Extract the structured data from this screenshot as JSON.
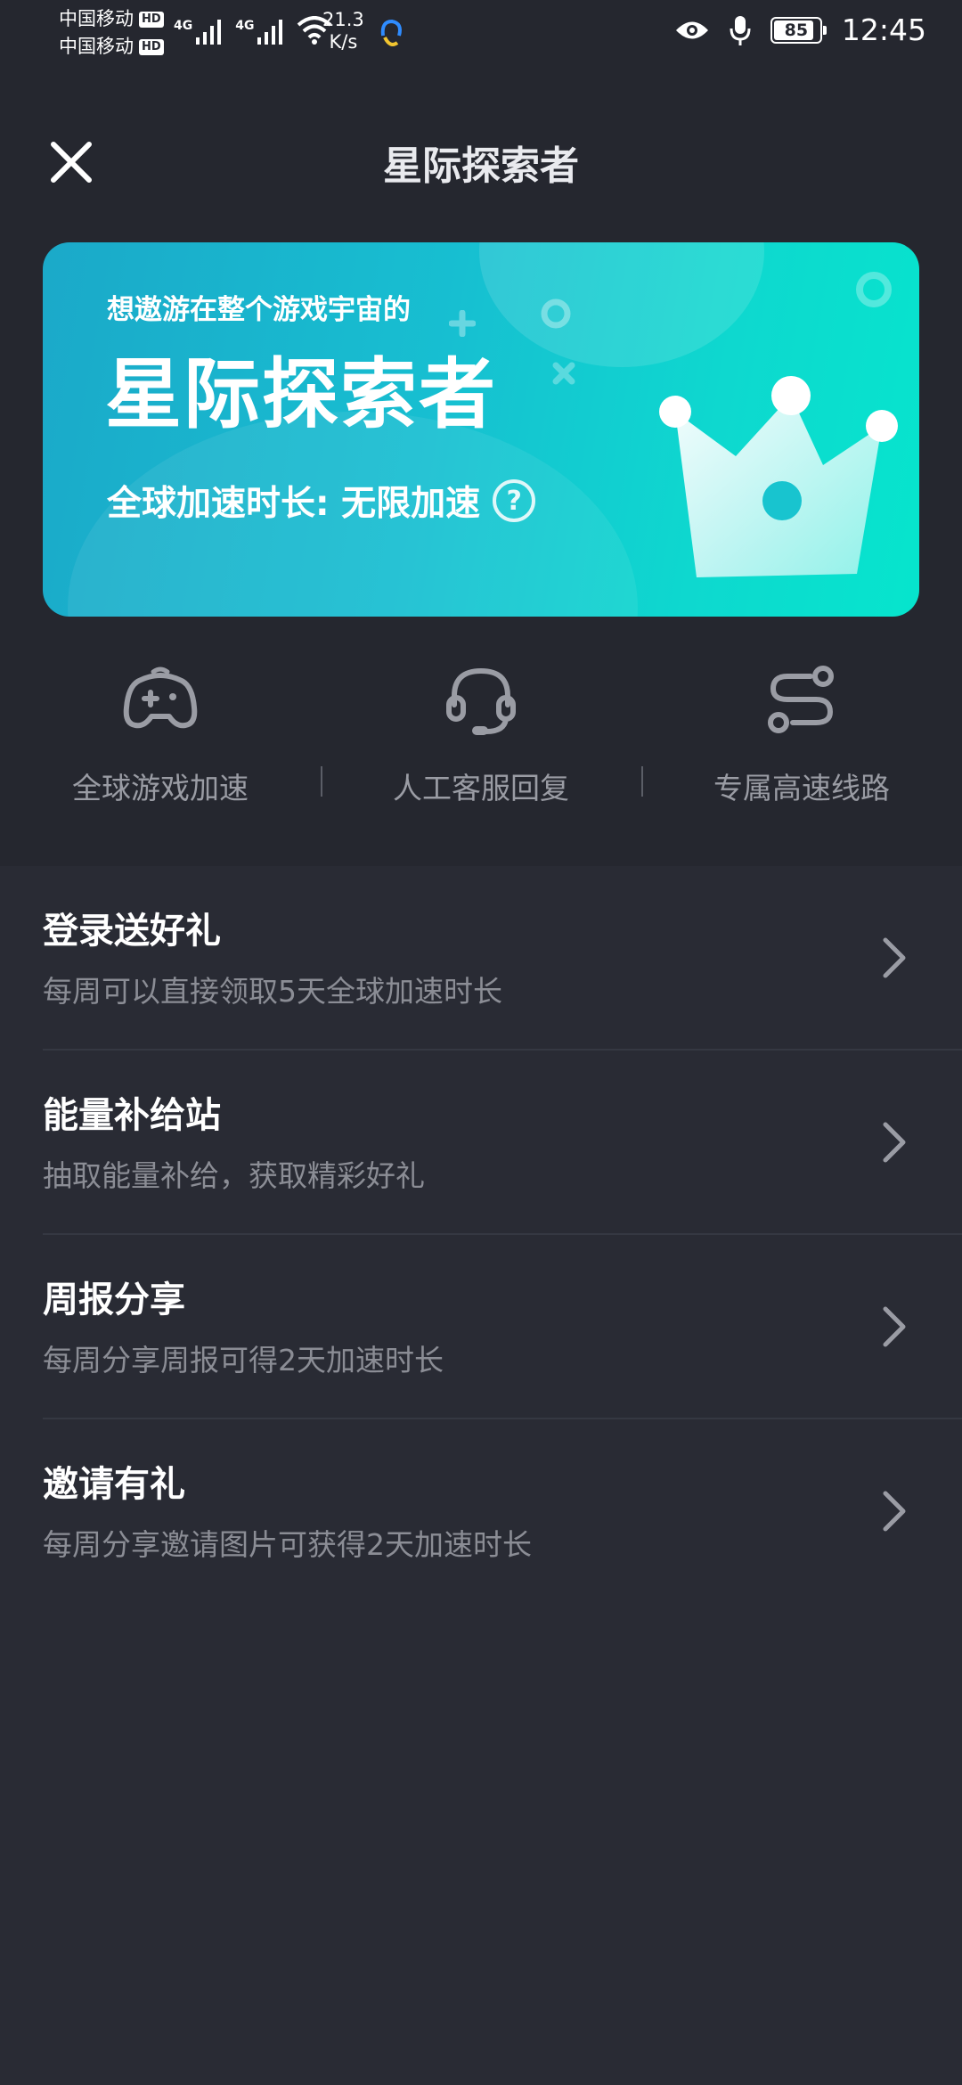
{
  "status": {
    "carrier1": "中国移动",
    "carrier2": "中国移动",
    "hd": "HD",
    "net1": "4G",
    "net2": "4G",
    "speed_value": "21.3",
    "speed_unit": "K/s",
    "battery": "85",
    "time": "12:45"
  },
  "header": {
    "title": "星际探索者"
  },
  "banner": {
    "subtitle": "想遨游在整个游戏宇宙的",
    "title": "星际探索者",
    "duration_label": "全球加速时长: 无限加速",
    "help_symbol": "?"
  },
  "features": [
    {
      "label": "全球游戏加速",
      "icon": "gamepad-icon"
    },
    {
      "label": "人工客服回复",
      "icon": "headset-icon"
    },
    {
      "label": "专属高速线路",
      "icon": "route-icon"
    }
  ],
  "list": [
    {
      "title": "登录送好礼",
      "subtitle": "每周可以直接领取5天全球加速时长"
    },
    {
      "title": "能量补给站",
      "subtitle": "抽取能量补给，获取精彩好礼"
    },
    {
      "title": "周报分享",
      "subtitle": "每周分享周报可得2天加速时长"
    },
    {
      "title": "邀请有礼",
      "subtitle": "每周分享邀请图片可获得2天加速时长"
    }
  ],
  "colors": {
    "background": "#25272f",
    "list_background": "#292b34",
    "banner_start": "#1ba9c9",
    "banner_end": "#06e5cd",
    "muted_text": "#9a9ca4"
  }
}
